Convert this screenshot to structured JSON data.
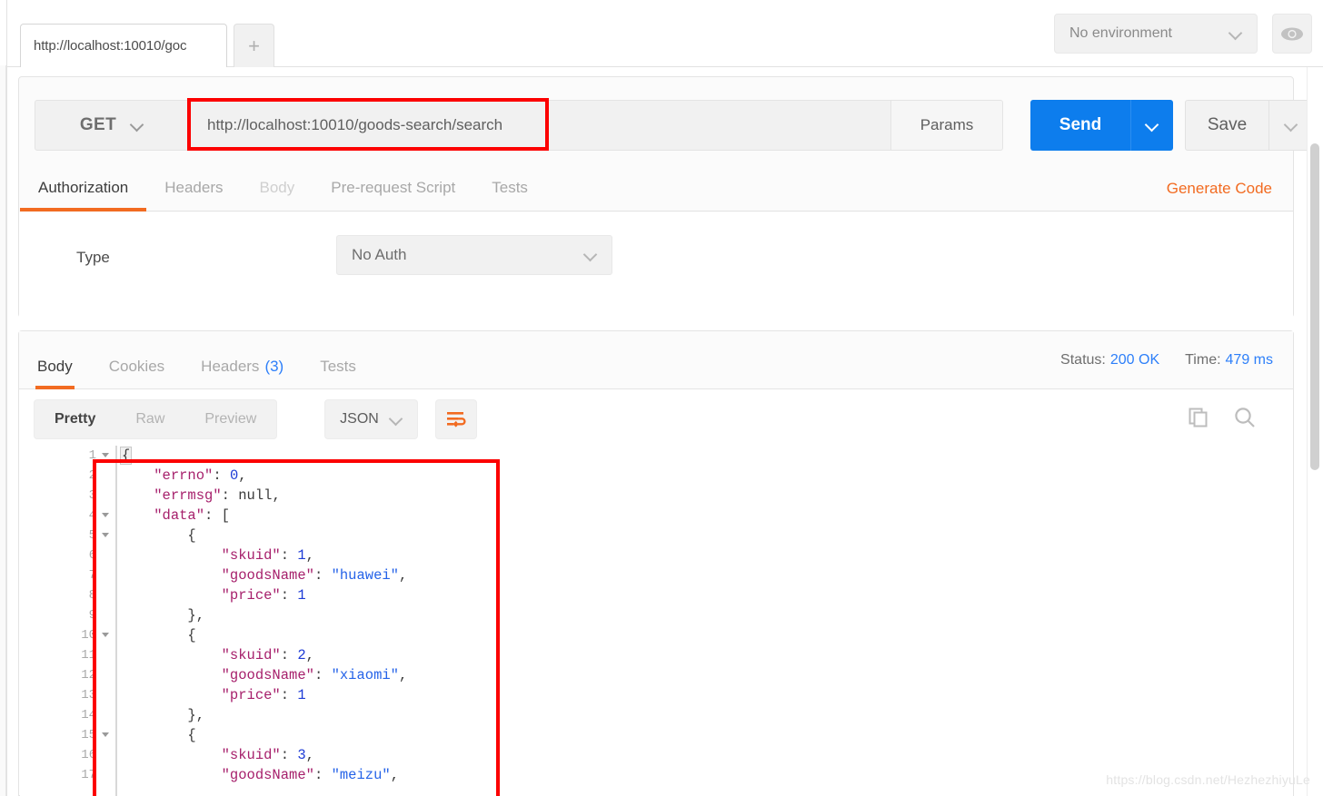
{
  "tabstrip": {
    "request_tab_label": "http://localhost:10010/goc",
    "new_tab_label": "+",
    "environment": {
      "selected": "No environment",
      "eye_icon": "eye-icon"
    }
  },
  "request": {
    "method": "GET",
    "url": "http://localhost:10010/goods-search/search",
    "params_label": "Params",
    "send_label": "Send",
    "save_label": "Save",
    "tabs": [
      {
        "label": "Authorization",
        "active": true,
        "dim": false
      },
      {
        "label": "Headers",
        "active": false,
        "dim": false
      },
      {
        "label": "Body",
        "active": false,
        "dim": true
      },
      {
        "label": "Pre-request Script",
        "active": false,
        "dim": false
      },
      {
        "label": "Tests",
        "active": false,
        "dim": false
      }
    ],
    "generate_code_label": "Generate Code",
    "authorization": {
      "type_label": "Type",
      "type_value": "No Auth"
    }
  },
  "response": {
    "tabs": [
      {
        "label": "Body",
        "active": true,
        "count": ""
      },
      {
        "label": "Cookies",
        "active": false,
        "count": ""
      },
      {
        "label": "Headers",
        "active": false,
        "count": "(3)"
      },
      {
        "label": "Tests",
        "active": false,
        "count": ""
      }
    ],
    "status_label": "Status:",
    "status_value": "200 OK",
    "time_label": "Time:",
    "time_value": "479 ms",
    "view_modes": [
      {
        "label": "Pretty",
        "active": true
      },
      {
        "label": "Raw",
        "active": false
      },
      {
        "label": "Preview",
        "active": false
      }
    ],
    "format": "JSON",
    "wrap_icon": "word-wrap-icon",
    "copy_icon": "copy-icon",
    "search_icon": "search-icon",
    "body_lines": [
      {
        "n": 1,
        "fold": true,
        "tokens": [
          {
            "t": "brace",
            "v": "{"
          }
        ]
      },
      {
        "n": 2,
        "fold": false,
        "tokens": [
          {
            "t": "pnc",
            "v": "    "
          },
          {
            "t": "k",
            "v": "\"errno\""
          },
          {
            "t": "pnc",
            "v": ": "
          },
          {
            "t": "num",
            "v": "0"
          },
          {
            "t": "pnc",
            "v": ","
          }
        ]
      },
      {
        "n": 3,
        "fold": false,
        "tokens": [
          {
            "t": "pnc",
            "v": "    "
          },
          {
            "t": "k",
            "v": "\"errmsg\""
          },
          {
            "t": "pnc",
            "v": ": "
          },
          {
            "t": "nul",
            "v": "null"
          },
          {
            "t": "pnc",
            "v": ","
          }
        ]
      },
      {
        "n": 4,
        "fold": true,
        "tokens": [
          {
            "t": "pnc",
            "v": "    "
          },
          {
            "t": "k",
            "v": "\"data\""
          },
          {
            "t": "pnc",
            "v": ": ["
          }
        ]
      },
      {
        "n": 5,
        "fold": true,
        "tokens": [
          {
            "t": "pnc",
            "v": "        {"
          }
        ]
      },
      {
        "n": 6,
        "fold": false,
        "tokens": [
          {
            "t": "pnc",
            "v": "            "
          },
          {
            "t": "k",
            "v": "\"skuid\""
          },
          {
            "t": "pnc",
            "v": ": "
          },
          {
            "t": "num",
            "v": "1"
          },
          {
            "t": "pnc",
            "v": ","
          }
        ]
      },
      {
        "n": 7,
        "fold": false,
        "tokens": [
          {
            "t": "pnc",
            "v": "            "
          },
          {
            "t": "k",
            "v": "\"goodsName\""
          },
          {
            "t": "pnc",
            "v": ": "
          },
          {
            "t": "str",
            "v": "\"huawei\""
          },
          {
            "t": "pnc",
            "v": ","
          }
        ]
      },
      {
        "n": 8,
        "fold": false,
        "tokens": [
          {
            "t": "pnc",
            "v": "            "
          },
          {
            "t": "k",
            "v": "\"price\""
          },
          {
            "t": "pnc",
            "v": ": "
          },
          {
            "t": "num",
            "v": "1"
          }
        ]
      },
      {
        "n": 9,
        "fold": false,
        "tokens": [
          {
            "t": "pnc",
            "v": "        },"
          }
        ]
      },
      {
        "n": 10,
        "fold": true,
        "tokens": [
          {
            "t": "pnc",
            "v": "        {"
          }
        ]
      },
      {
        "n": 11,
        "fold": false,
        "tokens": [
          {
            "t": "pnc",
            "v": "            "
          },
          {
            "t": "k",
            "v": "\"skuid\""
          },
          {
            "t": "pnc",
            "v": ": "
          },
          {
            "t": "num",
            "v": "2"
          },
          {
            "t": "pnc",
            "v": ","
          }
        ]
      },
      {
        "n": 12,
        "fold": false,
        "tokens": [
          {
            "t": "pnc",
            "v": "            "
          },
          {
            "t": "k",
            "v": "\"goodsName\""
          },
          {
            "t": "pnc",
            "v": ": "
          },
          {
            "t": "str",
            "v": "\"xiaomi\""
          },
          {
            "t": "pnc",
            "v": ","
          }
        ]
      },
      {
        "n": 13,
        "fold": false,
        "tokens": [
          {
            "t": "pnc",
            "v": "            "
          },
          {
            "t": "k",
            "v": "\"price\""
          },
          {
            "t": "pnc",
            "v": ": "
          },
          {
            "t": "num",
            "v": "1"
          }
        ]
      },
      {
        "n": 14,
        "fold": false,
        "tokens": [
          {
            "t": "pnc",
            "v": "        },"
          }
        ]
      },
      {
        "n": 15,
        "fold": true,
        "tokens": [
          {
            "t": "pnc",
            "v": "        {"
          }
        ]
      },
      {
        "n": 16,
        "fold": false,
        "tokens": [
          {
            "t": "pnc",
            "v": "            "
          },
          {
            "t": "k",
            "v": "\"skuid\""
          },
          {
            "t": "pnc",
            "v": ": "
          },
          {
            "t": "num",
            "v": "3"
          },
          {
            "t": "pnc",
            "v": ","
          }
        ]
      },
      {
        "n": 17,
        "fold": false,
        "tokens": [
          {
            "t": "pnc",
            "v": "            "
          },
          {
            "t": "k",
            "v": "\"goodsName\""
          },
          {
            "t": "pnc",
            "v": ": "
          },
          {
            "t": "str",
            "v": "\"meizu\""
          },
          {
            "t": "pnc",
            "v": ","
          }
        ]
      }
    ]
  },
  "watermark": "https://blog.csdn.net/HezhezhiyuLe",
  "colors": {
    "accent_orange": "#f26b21",
    "send_blue": "#0d7ded",
    "link_blue": "#2d7ff9",
    "annotation_red": "#fc0000"
  }
}
